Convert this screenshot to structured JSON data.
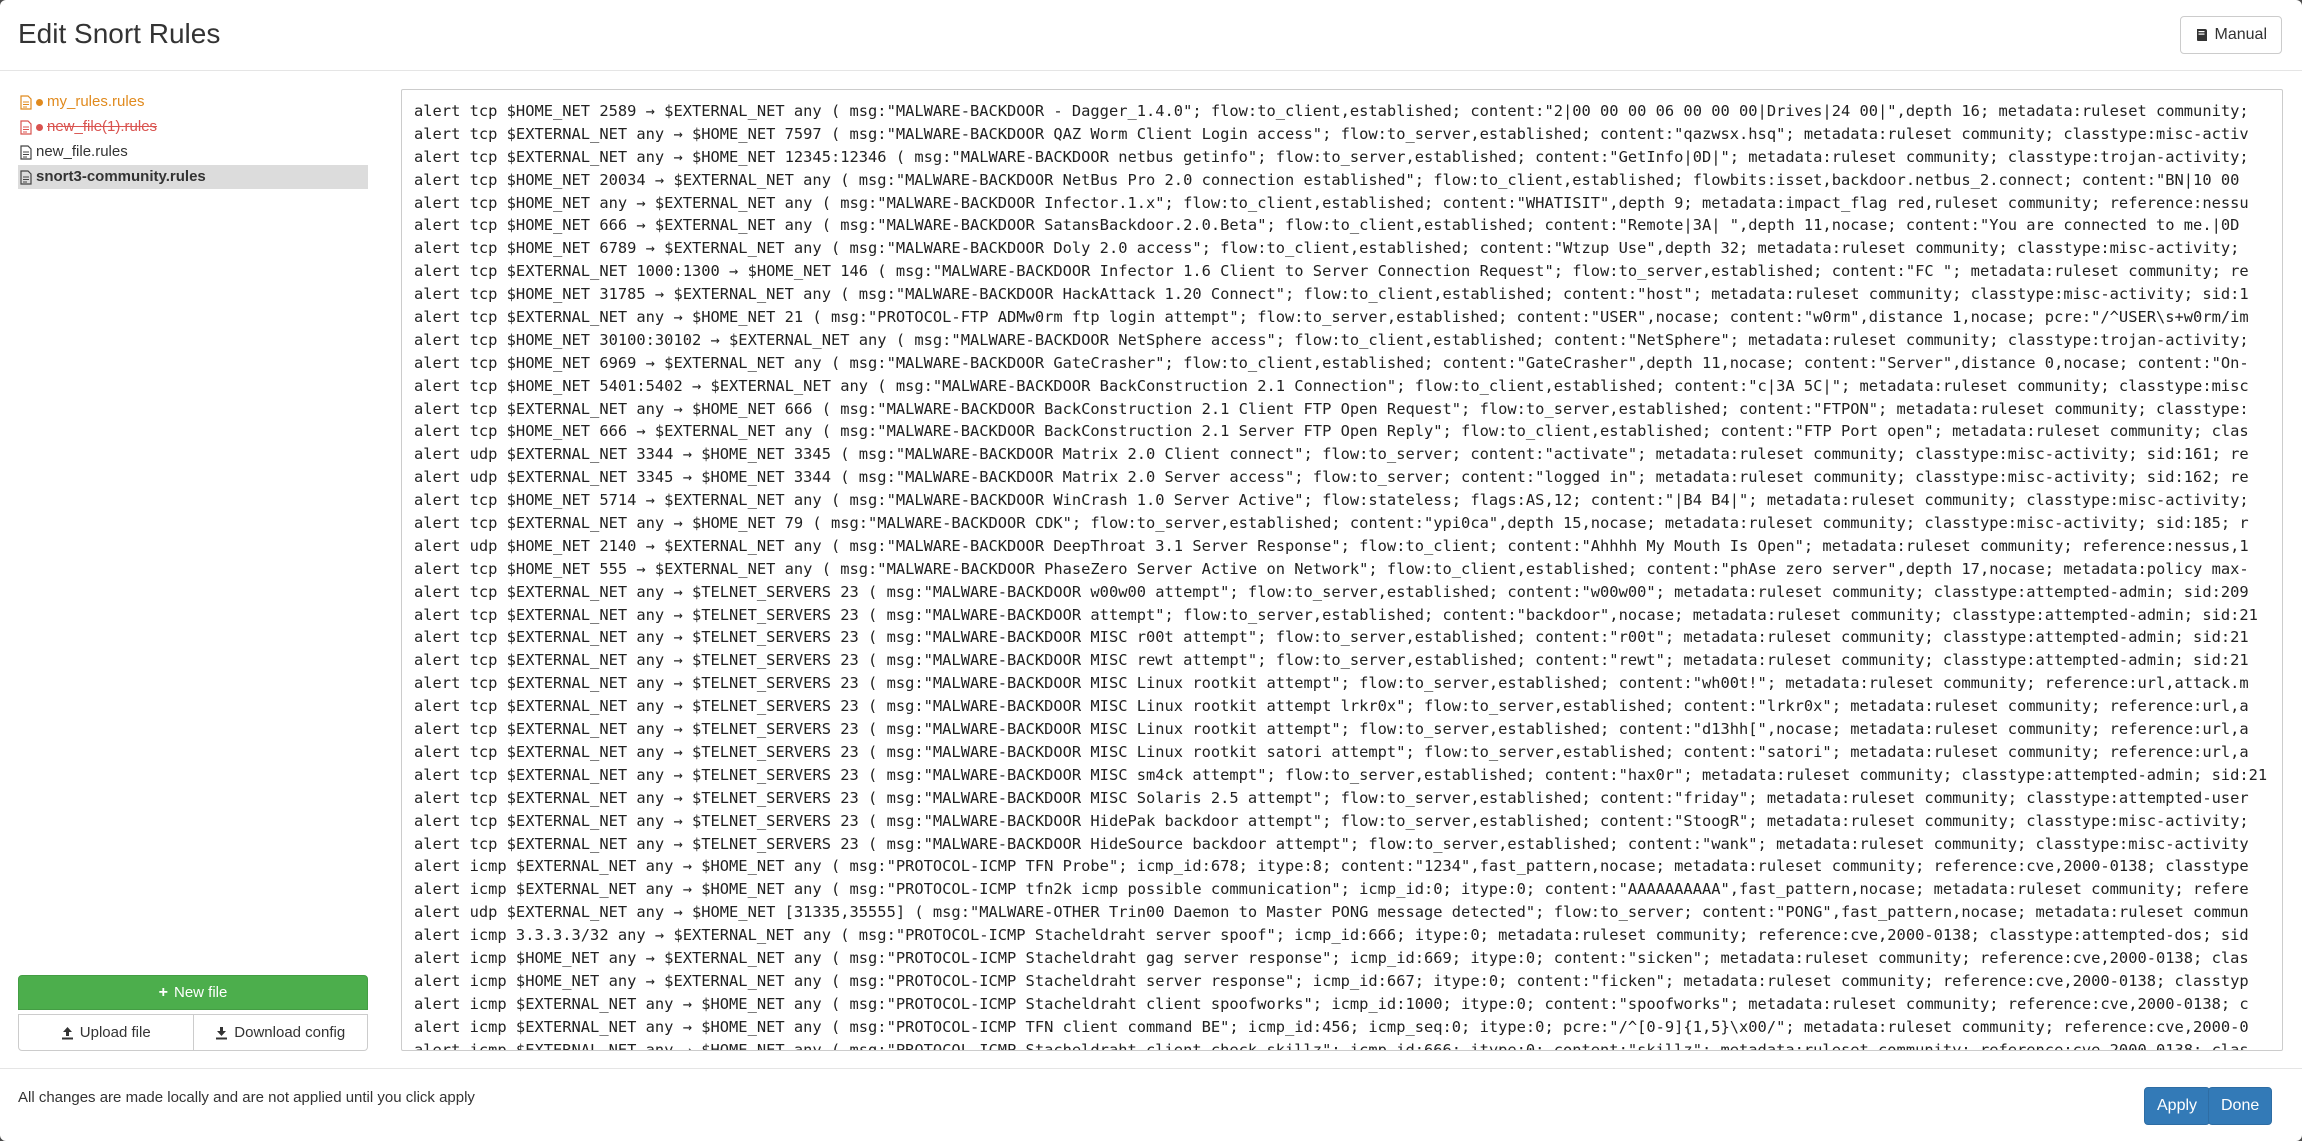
{
  "header": {
    "title": "Edit Snort Rules",
    "manual_label": "Manual"
  },
  "sidebar": {
    "files": [
      {
        "name": "my_rules.rules",
        "state": "modified"
      },
      {
        "name": "new_file(1).rules",
        "state": "deleted"
      },
      {
        "name": "new_file.rules",
        "state": "normal"
      },
      {
        "name": "snort3-community.rules",
        "state": "active"
      }
    ],
    "new_file_label": "New file",
    "upload_label": "Upload file",
    "download_label": "Download config"
  },
  "editor": {
    "lines": [
      "alert tcp $HOME_NET 2589 → $EXTERNAL_NET any ( msg:\"MALWARE-BACKDOOR - Dagger_1.4.0\"; flow:to_client,established; content:\"2|00 00 00 06 00 00 00|Drives|24 00|\",depth 16; metadata:ruleset community;",
      "alert tcp $EXTERNAL_NET any → $HOME_NET 7597 ( msg:\"MALWARE-BACKDOOR QAZ Worm Client Login access\"; flow:to_server,established; content:\"qazwsx.hsq\"; metadata:ruleset community; classtype:misc-activ",
      "alert tcp $EXTERNAL_NET any → $HOME_NET 12345:12346 ( msg:\"MALWARE-BACKDOOR netbus getinfo\"; flow:to_server,established; content:\"GetInfo|0D|\"; metadata:ruleset community; classtype:trojan-activity;",
      "alert tcp $HOME_NET 20034 → $EXTERNAL_NET any ( msg:\"MALWARE-BACKDOOR NetBus Pro 2.0 connection established\"; flow:to_client,established; flowbits:isset,backdoor.netbus_2.connect; content:\"BN|10 00",
      "alert tcp $HOME_NET any → $EXTERNAL_NET any ( msg:\"MALWARE-BACKDOOR Infector.1.x\"; flow:to_client,established; content:\"WHATISIT\",depth 9; metadata:impact_flag red,ruleset community; reference:nessu",
      "alert tcp $HOME_NET 666 → $EXTERNAL_NET any ( msg:\"MALWARE-BACKDOOR SatansBackdoor.2.0.Beta\"; flow:to_client,established; content:\"Remote|3A| \",depth 11,nocase; content:\"You are connected to me.|0D",
      "alert tcp $HOME_NET 6789 → $EXTERNAL_NET any ( msg:\"MALWARE-BACKDOOR Doly 2.0 access\"; flow:to_client,established; content:\"Wtzup Use\",depth 32; metadata:ruleset community; classtype:misc-activity;",
      "alert tcp $EXTERNAL_NET 1000:1300 → $HOME_NET 146 ( msg:\"MALWARE-BACKDOOR Infector 1.6 Client to Server Connection Request\"; flow:to_server,established; content:\"FC \"; metadata:ruleset community; re",
      "alert tcp $HOME_NET 31785 → $EXTERNAL_NET any ( msg:\"MALWARE-BACKDOOR HackAttack 1.20 Connect\"; flow:to_client,established; content:\"host\"; metadata:ruleset community; classtype:misc-activity; sid:1",
      "alert tcp $EXTERNAL_NET any → $HOME_NET 21 ( msg:\"PROTOCOL-FTP ADMw0rm ftp login attempt\"; flow:to_server,established; content:\"USER\",nocase; content:\"w0rm\",distance 1,nocase; pcre:\"/^USER\\s+w0rm/im",
      "alert tcp $HOME_NET 30100:30102 → $EXTERNAL_NET any ( msg:\"MALWARE-BACKDOOR NetSphere access\"; flow:to_client,established; content:\"NetSphere\"; metadata:ruleset community; classtype:trojan-activity;",
      "alert tcp $HOME_NET 6969 → $EXTERNAL_NET any ( msg:\"MALWARE-BACKDOOR GateCrasher\"; flow:to_client,established; content:\"GateCrasher\",depth 11,nocase; content:\"Server\",distance 0,nocase; content:\"On-",
      "alert tcp $HOME_NET 5401:5402 → $EXTERNAL_NET any ( msg:\"MALWARE-BACKDOOR BackConstruction 2.1 Connection\"; flow:to_client,established; content:\"c|3A 5C|\"; metadata:ruleset community; classtype:misc",
      "alert tcp $EXTERNAL_NET any → $HOME_NET 666 ( msg:\"MALWARE-BACKDOOR BackConstruction 2.1 Client FTP Open Request\"; flow:to_server,established; content:\"FTPON\"; metadata:ruleset community; classtype:",
      "alert tcp $HOME_NET 666 → $EXTERNAL_NET any ( msg:\"MALWARE-BACKDOOR BackConstruction 2.1 Server FTP Open Reply\"; flow:to_client,established; content:\"FTP Port open\"; metadata:ruleset community; clas",
      "alert udp $EXTERNAL_NET 3344 → $HOME_NET 3345 ( msg:\"MALWARE-BACKDOOR Matrix 2.0 Client connect\"; flow:to_server; content:\"activate\"; metadata:ruleset community; classtype:misc-activity; sid:161; re",
      "alert udp $EXTERNAL_NET 3345 → $HOME_NET 3344 ( msg:\"MALWARE-BACKDOOR Matrix 2.0 Server access\"; flow:to_server; content:\"logged in\"; metadata:ruleset community; classtype:misc-activity; sid:162; re",
      "alert tcp $HOME_NET 5714 → $EXTERNAL_NET any ( msg:\"MALWARE-BACKDOOR WinCrash 1.0 Server Active\"; flow:stateless; flags:AS,12; content:\"|B4 B4|\"; metadata:ruleset community; classtype:misc-activity;",
      "alert tcp $EXTERNAL_NET any → $HOME_NET 79 ( msg:\"MALWARE-BACKDOOR CDK\"; flow:to_server,established; content:\"ypi0ca\",depth 15,nocase; metadata:ruleset community; classtype:misc-activity; sid:185; r",
      "alert udp $HOME_NET 2140 → $EXTERNAL_NET any ( msg:\"MALWARE-BACKDOOR DeepThroat 3.1 Server Response\"; flow:to_client; content:\"Ahhhh My Mouth Is Open\"; metadata:ruleset community; reference:nessus,1",
      "alert tcp $HOME_NET 555 → $EXTERNAL_NET any ( msg:\"MALWARE-BACKDOOR PhaseZero Server Active on Network\"; flow:to_client,established; content:\"phAse zero server\",depth 17,nocase; metadata:policy max-",
      "alert tcp $EXTERNAL_NET any → $TELNET_SERVERS 23 ( msg:\"MALWARE-BACKDOOR w00w00 attempt\"; flow:to_server,established; content:\"w00w00\"; metadata:ruleset community; classtype:attempted-admin; sid:209",
      "alert tcp $EXTERNAL_NET any → $TELNET_SERVERS 23 ( msg:\"MALWARE-BACKDOOR attempt\"; flow:to_server,established; content:\"backdoor\",nocase; metadata:ruleset community; classtype:attempted-admin; sid:21",
      "alert tcp $EXTERNAL_NET any → $TELNET_SERVERS 23 ( msg:\"MALWARE-BACKDOOR MISC r00t attempt\"; flow:to_server,established; content:\"r00t\"; metadata:ruleset community; classtype:attempted-admin; sid:21",
      "alert tcp $EXTERNAL_NET any → $TELNET_SERVERS 23 ( msg:\"MALWARE-BACKDOOR MISC rewt attempt\"; flow:to_server,established; content:\"rewt\"; metadata:ruleset community; classtype:attempted-admin; sid:21",
      "alert tcp $EXTERNAL_NET any → $TELNET_SERVERS 23 ( msg:\"MALWARE-BACKDOOR MISC Linux rootkit attempt\"; flow:to_server,established; content:\"wh00t!\"; metadata:ruleset community; reference:url,attack.m",
      "alert tcp $EXTERNAL_NET any → $TELNET_SERVERS 23 ( msg:\"MALWARE-BACKDOOR MISC Linux rootkit attempt lrkr0x\"; flow:to_server,established; content:\"lrkr0x\"; metadata:ruleset community; reference:url,a",
      "alert tcp $EXTERNAL_NET any → $TELNET_SERVERS 23 ( msg:\"MALWARE-BACKDOOR MISC Linux rootkit attempt\"; flow:to_server,established; content:\"d13hh[\",nocase; metadata:ruleset community; reference:url,a",
      "alert tcp $EXTERNAL_NET any → $TELNET_SERVERS 23 ( msg:\"MALWARE-BACKDOOR MISC Linux rootkit satori attempt\"; flow:to_server,established; content:\"satori\"; metadata:ruleset community; reference:url,a",
      "alert tcp $EXTERNAL_NET any → $TELNET_SERVERS 23 ( msg:\"MALWARE-BACKDOOR MISC sm4ck attempt\"; flow:to_server,established; content:\"hax0r\"; metadata:ruleset community; classtype:attempted-admin; sid:21",
      "alert tcp $EXTERNAL_NET any → $TELNET_SERVERS 23 ( msg:\"MALWARE-BACKDOOR MISC Solaris 2.5 attempt\"; flow:to_server,established; content:\"friday\"; metadata:ruleset community; classtype:attempted-user",
      "alert tcp $EXTERNAL_NET any → $TELNET_SERVERS 23 ( msg:\"MALWARE-BACKDOOR HidePak backdoor attempt\"; flow:to_server,established; content:\"StoogR\"; metadata:ruleset community; classtype:misc-activity;",
      "alert tcp $EXTERNAL_NET any → $TELNET_SERVERS 23 ( msg:\"MALWARE-BACKDOOR HideSource backdoor attempt\"; flow:to_server,established; content:\"wank\"; metadata:ruleset community; classtype:misc-activity",
      "alert icmp $EXTERNAL_NET any → $HOME_NET any ( msg:\"PROTOCOL-ICMP TFN Probe\"; icmp_id:678; itype:8; content:\"1234\",fast_pattern,nocase; metadata:ruleset community; reference:cve,2000-0138; classtype",
      "alert icmp $EXTERNAL_NET any → $HOME_NET any ( msg:\"PROTOCOL-ICMP tfn2k icmp possible communication\"; icmp_id:0; itype:0; content:\"AAAAAAAAAA\",fast_pattern,nocase; metadata:ruleset community; refere",
      "alert udp $EXTERNAL_NET any → $HOME_NET [31335,35555] ( msg:\"MALWARE-OTHER Trin00 Daemon to Master PONG message detected\"; flow:to_server; content:\"PONG\",fast_pattern,nocase; metadata:ruleset commun",
      "alert icmp 3.3.3.3/32 any → $EXTERNAL_NET any ( msg:\"PROTOCOL-ICMP Stacheldraht server spoof\"; icmp_id:666; itype:0; metadata:ruleset community; reference:cve,2000-0138; classtype:attempted-dos; sid",
      "alert icmp $HOME_NET any → $EXTERNAL_NET any ( msg:\"PROTOCOL-ICMP Stacheldraht gag server response\"; icmp_id:669; itype:0; content:\"sicken\"; metadata:ruleset community; reference:cve,2000-0138; clas",
      "alert icmp $HOME_NET any → $EXTERNAL_NET any ( msg:\"PROTOCOL-ICMP Stacheldraht server response\"; icmp_id:667; itype:0; content:\"ficken\"; metadata:ruleset community; reference:cve,2000-0138; classtyp",
      "alert icmp $EXTERNAL_NET any → $HOME_NET any ( msg:\"PROTOCOL-ICMP Stacheldraht client spoofworks\"; icmp_id:1000; itype:0; content:\"spoofworks\"; metadata:ruleset community; reference:cve,2000-0138; c",
      "alert icmp $EXTERNAL_NET any → $HOME_NET any ( msg:\"PROTOCOL-ICMP TFN client command BE\"; icmp_id:456; icmp_seq:0; itype:0; pcre:\"/^[0-9]{1,5}\\x00/\"; metadata:ruleset community; reference:cve,2000-0",
      "alert icmp $EXTERNAL_NET any → $HOME_NET any ( msg:\"PROTOCOL-ICMP Stacheldraht client check skillz\"; icmp_id:666; itype:0; content:\"skillz\"; metadata:ruleset community; reference:cve,2000-0138; clas"
    ]
  },
  "footer": {
    "note": "All changes are made locally and are not applied until you click apply",
    "apply_label": "Apply",
    "done_label": "Done"
  },
  "colors": {
    "accent_primary": "#337ab7",
    "success": "#4cae4c",
    "modified": "#e08a1e",
    "deleted": "#d9534f"
  }
}
